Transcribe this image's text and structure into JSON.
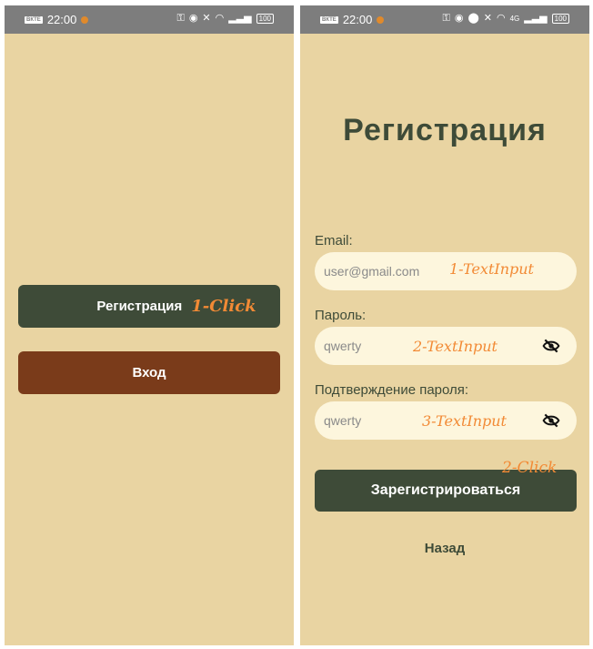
{
  "left_screen": {
    "status": {
      "time": "22:00",
      "chip": "ВКТЕ",
      "battery": "100"
    },
    "register_button": "Регистрация",
    "login_button": "Вход",
    "annotation_register": "1-Click"
  },
  "right_screen": {
    "status": {
      "time": "22:00",
      "chip": "ВКТЕ",
      "battery": "100",
      "network": "4G"
    },
    "title": "Регистрация",
    "email": {
      "label": "Email:",
      "placeholder": "user@gmail.com",
      "annotation": "1-TextInput"
    },
    "password": {
      "label": "Пароль:",
      "value": "qwerty",
      "annotation": "2-TextInput",
      "icon": "eye-off-icon"
    },
    "confirm": {
      "label": "Подтверждение пароля:",
      "value": "qwerty",
      "annotation": "3-TextInput",
      "icon": "eye-off-icon"
    },
    "submit_button": "Зарегистрироваться",
    "submit_annotation": "2-Click",
    "back_link": "Назад"
  },
  "colors": {
    "background": "#e9d4a2",
    "primary": "#3e4b38",
    "secondary": "#7a3b1a",
    "field": "#fdf6dd",
    "annotation": "#f28a35",
    "statusbar": "#7d7d7d"
  }
}
